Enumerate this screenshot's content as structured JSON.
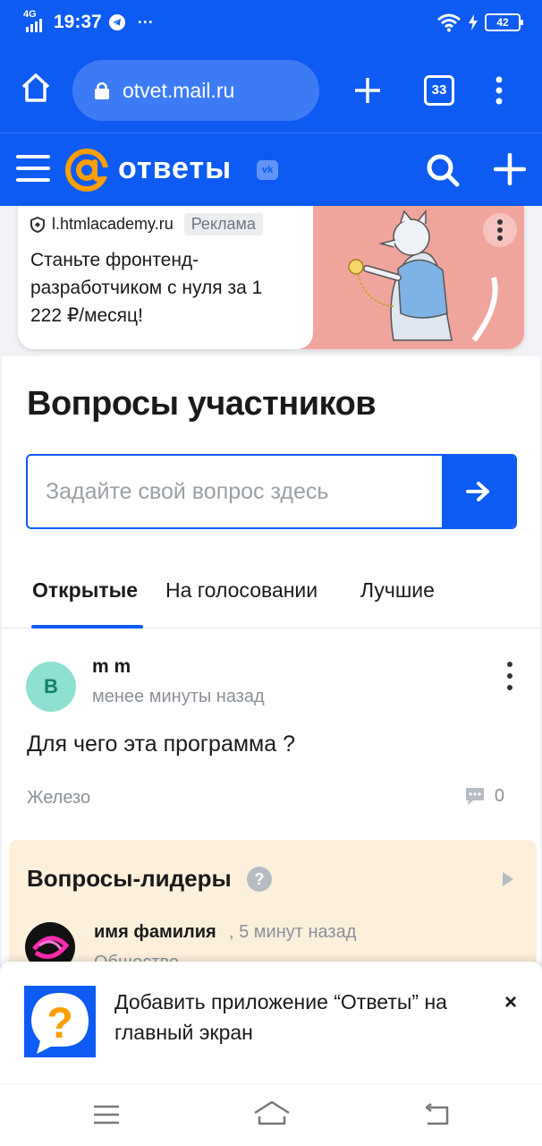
{
  "status_bar": {
    "network": "4G",
    "time": "19:37",
    "more": "···",
    "battery": "42"
  },
  "browser": {
    "url": "otvet.mail.ru",
    "tabs_count": "33"
  },
  "site_header": {
    "logo_text": "ответы",
    "vk_badge": "vk"
  },
  "ad": {
    "source": "l.htmlacademy.ru",
    "label": "Реклама",
    "title": "Станьте фронтенд-разработчиком с нуля за 1 222 ₽/месяц!"
  },
  "main": {
    "title": "Вопросы участников",
    "search": {
      "placeholder": "Задайте свой вопрос здесь",
      "value": ""
    },
    "tabs": [
      {
        "label": "Открытые",
        "active": true
      },
      {
        "label": "На голосовании",
        "active": false
      },
      {
        "label": "Лучшие",
        "active": false
      }
    ],
    "question": {
      "avatar_letter": "B",
      "author": "m m",
      "time": "менее минуты назад",
      "text": "Для чего эта программа ?",
      "category": "Железо",
      "comments": "0"
    },
    "leaders": {
      "title": "Вопросы-лидеры",
      "help": "?",
      "item": {
        "author": "имя фамилия",
        "time": ", 5 минут назад",
        "category": "Общество"
      }
    }
  },
  "install_banner": {
    "text": "Добавить приложение “Ответы” на главный экран",
    "close": "×"
  },
  "colors": {
    "brand_blue": "#0d5bf2",
    "logo_orange": "#ff9e00",
    "leaders_bg": "#fdf0db"
  }
}
